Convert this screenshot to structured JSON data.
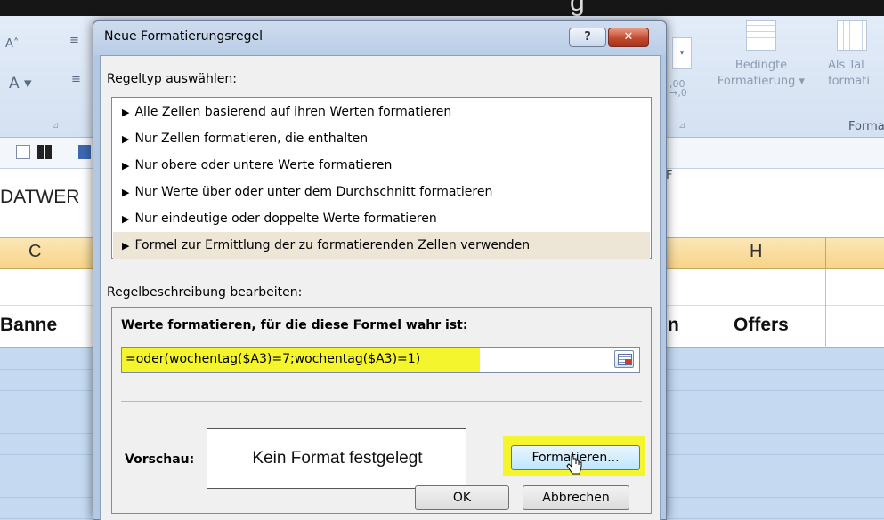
{
  "top_strip": {
    "partial_glyph": "g"
  },
  "ribbon": {
    "left_icons": {
      "font_grow": "A˄",
      "font_color": "A ▾",
      "align_1": "≡",
      "align_2": "≡"
    },
    "number_dropdown_arrow": "▾",
    "decimal_icon": ",00\n→,0",
    "conditional_formatting": {
      "line1": "Bedingte",
      "line2": "Formatierung ▾"
    },
    "table_format": {
      "line1": "Als Tal",
      "line2": "formati"
    },
    "group_label": "Forma"
  },
  "formula_bar": {
    "name_box_partial": "DATWER",
    "f_partial": "F"
  },
  "sheet": {
    "columns": [
      "C",
      "H"
    ],
    "header_row": {
      "col_b": "Banne",
      "col_g": "n",
      "col_h": "Offers"
    }
  },
  "dialog": {
    "title": "Neue Formatierungsregel",
    "help_label": "?",
    "close_label": "✕",
    "rule_type_label": "Regeltyp auswählen:",
    "rule_types": [
      "Alle Zellen basierend auf ihren Werten formatieren",
      "Nur Zellen formatieren, die enthalten",
      "Nur obere oder untere Werte formatieren",
      "Nur Werte über oder unter dem Durchschnitt formatieren",
      "Nur eindeutige oder doppelte Werte formatieren",
      "Formel zur Ermittlung der zu formatierenden Zellen verwenden"
    ],
    "selected_rule_index": 5,
    "description_label": "Regelbeschreibung bearbeiten:",
    "formula_heading": "Werte formatieren, für die diese Formel wahr ist:",
    "formula_value": "=oder(wochentag($A3)=7;wochentag($A3)=1)",
    "preview_label": "Vorschau:",
    "preview_text": "Kein Format festgelegt",
    "format_button": "Formatieren...",
    "ok_button": "OK",
    "cancel_button": "Abbrechen"
  },
  "colors": {
    "highlight": "#f5f52e",
    "selected_rule_bg": "#ede6d6",
    "column_header": "#f7d488",
    "data_rows": "#c5daf1",
    "close_button": "#c04a2f"
  }
}
